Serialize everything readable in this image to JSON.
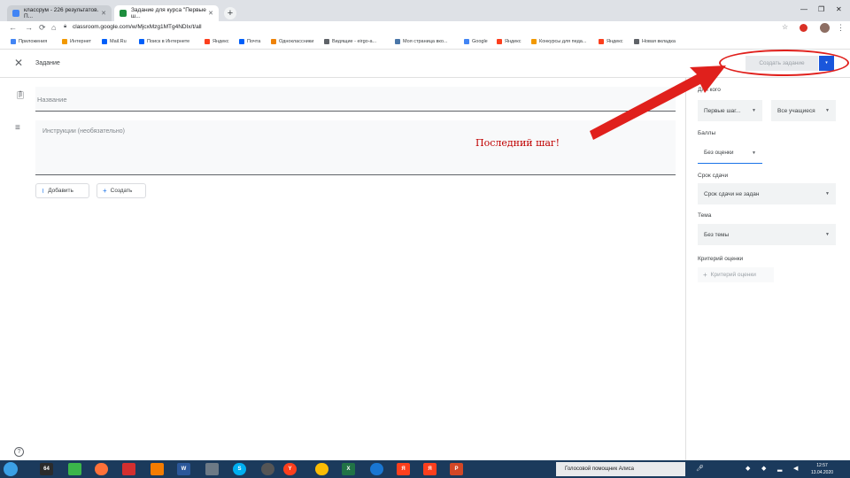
{
  "browser": {
    "tabs": [
      {
        "label": "классрум - 226 результатов. П...",
        "close": "✕"
      },
      {
        "label": "Задание для курса \"Первые ш...",
        "close": "✕"
      }
    ],
    "new_tab": "+",
    "url": "classroom.google.com/w/MjcxMzg1MTg4NDIx/t/all",
    "bookmarks": [
      "Приложения",
      "Интернет",
      "Mail.Ru",
      "Поиск в Интернете",
      "Яндекс",
      "Почта",
      "Одноклассники",
      "Видящие - eirgo-а...",
      "Моя страница вко...",
      "Google",
      "Яндекс",
      "Конкурсы для педа...",
      "Яндекс",
      "Новая вкладка"
    ]
  },
  "app": {
    "close_icon": "close-icon",
    "title": "Задание",
    "create_button": "Создать задание",
    "dropdown_icon": "▾"
  },
  "form": {
    "title_placeholder": "Название",
    "instructions_placeholder": "Инструкции (необязательно)",
    "add_button": "Добавить",
    "create_button": "Создать"
  },
  "annotation": {
    "text": "Последний шаг!",
    "color": "#e0201c"
  },
  "panel": {
    "for_label": "Для кого",
    "class_select": "Первые шаг...",
    "students_select": "Все учащиеся",
    "points_label": "Баллы",
    "points_select": "Без оценки",
    "due_label": "Срок сдачи",
    "due_select": "Срок сдачи не задан",
    "topic_label": "Тема",
    "topic_select": "Без темы",
    "rubric_label": "Критерий оценки",
    "rubric_button": "Критерий оценки"
  },
  "taskbar": {
    "alisa_label": "Голосовой помощник Алиса",
    "time": "12:57",
    "date": "13.04.2020",
    "icons": [
      "start-icon",
      "64",
      "messenger-icon",
      "firefox-icon",
      "pdf-icon",
      "media-icon",
      "word-icon",
      "sound-icon",
      "skype-icon",
      "yandex-icon",
      "chrome-icon",
      "excel-icon",
      "bluetooth-icon",
      "yandex-icon",
      "yandex-icon",
      "powerpoint-icon"
    ]
  },
  "colors": {
    "accent": "#1a56db",
    "annotation_red": "#e0201c",
    "taskbar": "#1b3a5c"
  }
}
